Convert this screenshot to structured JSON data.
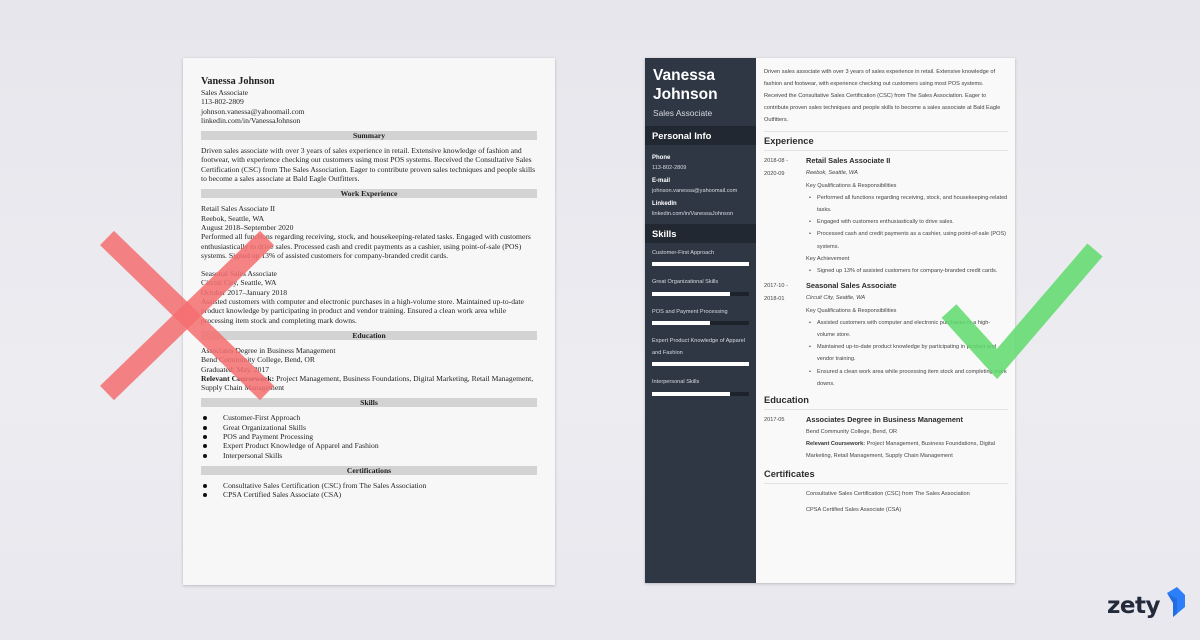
{
  "brand": {
    "name": "zety",
    "accent": "#2d7ff9"
  },
  "marks": {
    "bad": {
      "label": "incorrect",
      "color": "#f46f70"
    },
    "good": {
      "label": "correct",
      "color": "#5fdb6c"
    }
  },
  "bad_resume": {
    "name": "Vanessa Johnson",
    "title": "Sales Associate",
    "phone": "113-802-2809",
    "email": "johnson.vanessa@yahoomail.com",
    "linkedin": "linkedin.com/in/VanessaJohnson",
    "sections": {
      "summary": "Summary",
      "work": "Work Experience",
      "education": "Education",
      "skills": "Skills",
      "certifications": "Certifications"
    },
    "summary": "Driven sales associate with over 3 years of sales experience in retail. Extensive knowledge of fashion and footwear, with experience checking out customers using most POS systems. Received the Consultative Sales Certification (CSC) from The Sales Association. Eager to contribute proven sales techniques and people skills to become a sales associate at Bald Eagle Outfitters.",
    "jobs": [
      {
        "title": "Retail Sales Associate II",
        "company": "Reebok, Seattle, WA",
        "dates": "August 2018–September 2020",
        "description": "Performed all functions regarding receiving, stock, and housekeeping-related tasks. Engaged with customers enthusiastically to drive sales. Processed cash and credit payments as a cashier, using point-of-sale (POS) systems. Signed up 13% of assisted customers for company-branded credit cards."
      },
      {
        "title": "Seasonal Sales Associate",
        "company": "Circuit City, Seattle, WA",
        "dates": "October 2017–January 2018",
        "description": "Assisted customers with computer and electronic purchases in a high-volume store. Maintained up-to-date product knowledge by participating in product and vendor training. Ensured a clean work area while processing item stock and completing mark downs."
      }
    ],
    "education": {
      "degree": "Associates Degree in Business Management",
      "school": "Bend Community College, Bend, OR",
      "graduated": "Graduated: May, 2017",
      "coursework_label": "Relevant Coursework:",
      "coursework": " Project Management, Business Foundations, Digital Marketing, Retail Management, Supply Chain Management"
    },
    "skills": [
      "Customer-First Approach",
      "Great Organizational Skills",
      "POS and Payment Processing",
      "Expert Product Knowledge of Apparel and Fashion",
      "Interpersonal Skills"
    ],
    "certifications": [
      "Consultative Sales Certification (CSC) from The Sales Association",
      "CPSA Certified Sales Associate (CSA)"
    ]
  },
  "good_resume": {
    "name_first": "Vanessa",
    "name_last": "Johnson",
    "title": "Sales Associate",
    "sidebar": {
      "personal_info_heading": "Personal Info",
      "phone_label": "Phone",
      "phone": "113-802-2809",
      "email_label": "E-mail",
      "email": "johnson.vanessa@yahoomail.com",
      "linkedin_label": "LinkedIn",
      "linkedin": "linkedin.com/in/VanessaJohnson",
      "skills_heading": "Skills",
      "skills": [
        {
          "name": "Customer-First Approach",
          "level": 1.0
        },
        {
          "name": "Great Organizational Skills",
          "level": 0.8
        },
        {
          "name": "POS and Payment Processing",
          "level": 0.6
        },
        {
          "name": "Expert Product Knowledge of Apparel and Fashion",
          "level": 1.0
        },
        {
          "name": "Interpersonal Skills",
          "level": 0.8
        }
      ]
    },
    "summary": "Driven sales associate with over 3 years of sales experience in retail. Extensive knowledge of fashion and footwear, with experience checking out customers using most POS systems. Received the Consultative Sales Certification (CSC) from The Sales Association. Eager to contribute proven sales techniques and people skills to become a sales associate at Bald Eagle Outfitters.",
    "experience_heading": "Experience",
    "jobs": [
      {
        "date_start": "2018-08 -",
        "date_end": "2020-09",
        "title": "Retail Sales Associate II",
        "company": "Reebok, Seattle, WA",
        "qualifications_label": "Key Qualifications & Responsibilities",
        "bullets": [
          "Performed all functions regarding receiving, stock, and housekeeping-related tasks.",
          "Engaged with customers enthusiastically to drive sales.",
          "Processed cash and credit payments as a cashier, using point-of-sale (POS) systems."
        ],
        "achievement_label": "Key Achievement",
        "achievements": [
          "Signed up 13% of assisted customers for company-branded credit cards."
        ]
      },
      {
        "date_start": "2017-10 -",
        "date_end": "2018-01",
        "title": "Seasonal Sales Associate",
        "company": "Circuit City, Seattle, WA",
        "qualifications_label": "Key Qualifications & Responsibilities",
        "bullets": [
          "Assisted customers with computer and electronic purchases in a high-volume store.",
          "Maintained up-to-date product knowledge by participating in product and vendor training.",
          "Ensured a clean work area while processing item stock and completing mark downs."
        ]
      }
    ],
    "education_heading": "Education",
    "education": {
      "date": "2017-05",
      "degree": "Associates Degree in Business Management",
      "school": "Bend Community College, Bend, OR",
      "coursework_label": "Relevant Coursework:",
      "coursework": " Project Management, Business Foundations, Digital Marketing, Retail Management, Supply Chain Management"
    },
    "certificates_heading": "Certificates",
    "certificates": [
      "Consultative Sales Certification (CSC) from The Sales Association",
      "CPSA Certified Sales Associate (CSA)"
    ]
  }
}
